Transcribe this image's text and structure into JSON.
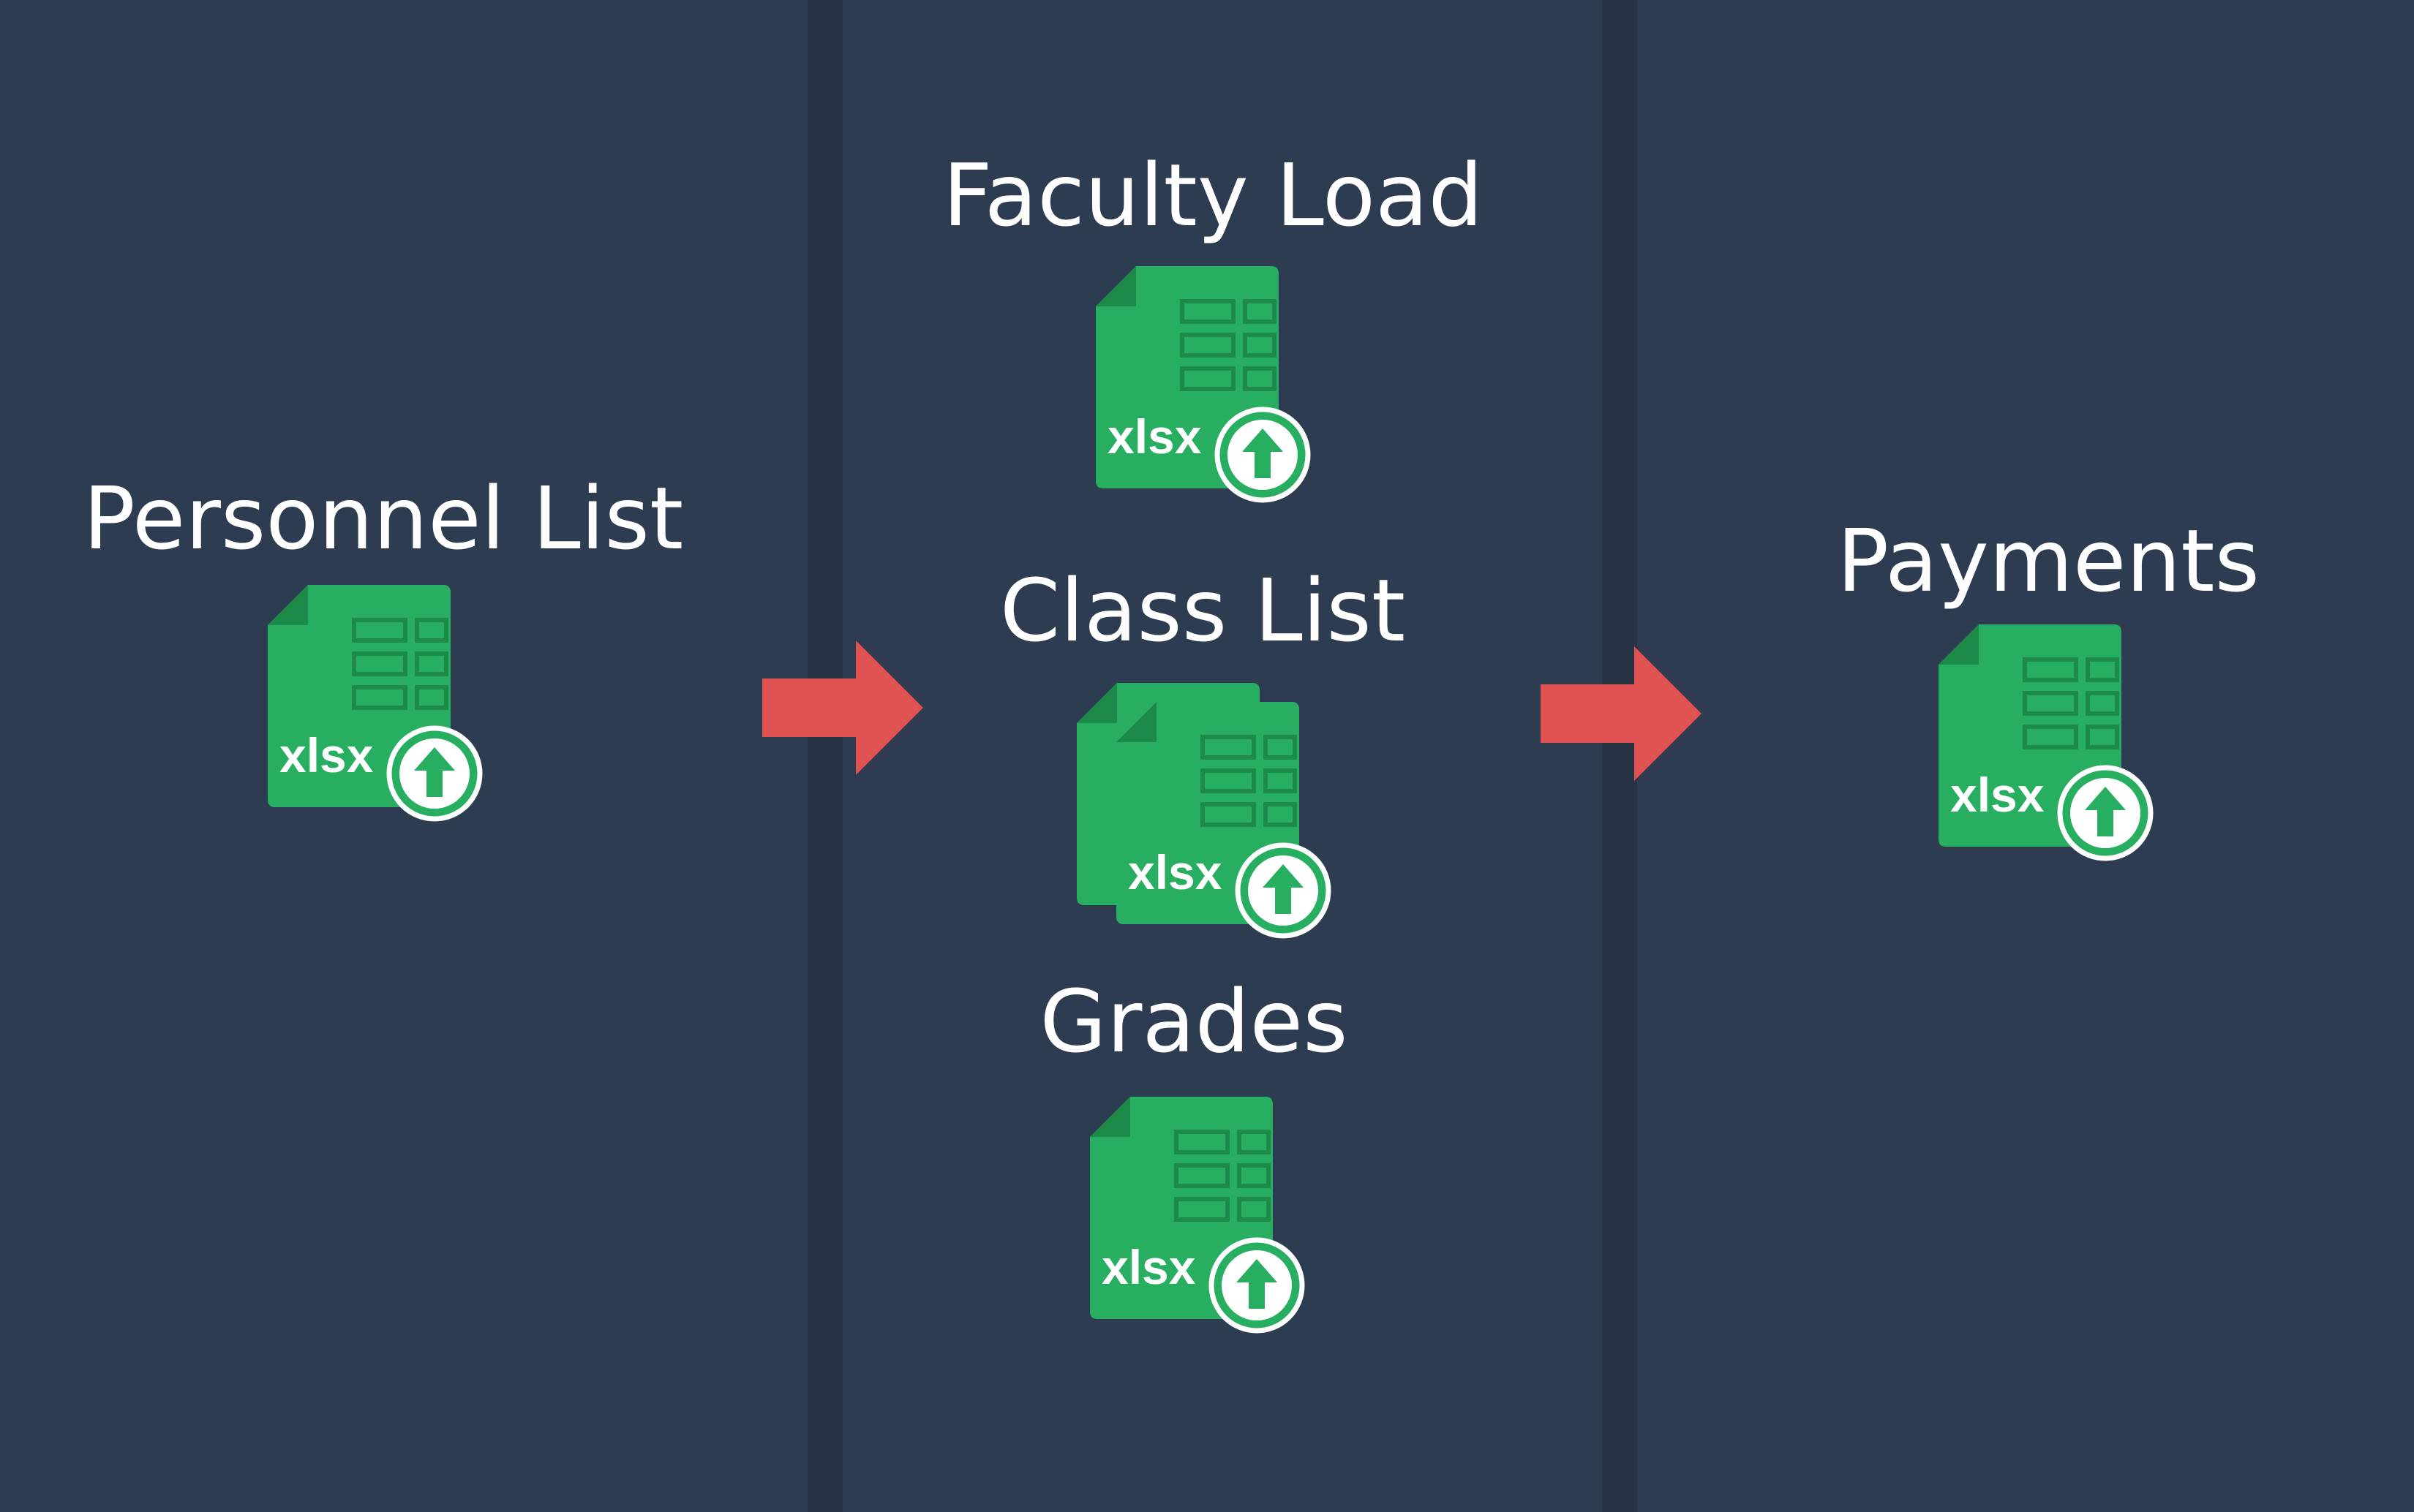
{
  "colors": {
    "background": "#2d3c50",
    "divider": "#283443",
    "file_green": "#27ae60",
    "file_fold": "#1e8a4a",
    "arrow_red": "#e05252",
    "text": "#ffffff"
  },
  "stages": [
    {
      "files": [
        {
          "label": "Personnel List",
          "icon": "xlsx-upload-icon",
          "badge": "xlsx",
          "stacked": false
        }
      ]
    },
    {
      "files": [
        {
          "label": "Faculty Load",
          "icon": "xlsx-upload-icon",
          "badge": "xlsx",
          "stacked": false
        },
        {
          "label": "Class List",
          "icon": "xlsx-upload-multi-icon",
          "badge": "xlsx",
          "stacked": true
        },
        {
          "label": "Grades",
          "icon": "xlsx-upload-icon",
          "badge": "xlsx",
          "stacked": false
        }
      ]
    },
    {
      "files": [
        {
          "label": "Payments",
          "icon": "xlsx-upload-icon",
          "badge": "xlsx",
          "stacked": false
        }
      ]
    }
  ],
  "arrows": [
    {
      "icon": "right-arrow-icon"
    },
    {
      "icon": "right-arrow-icon"
    }
  ]
}
